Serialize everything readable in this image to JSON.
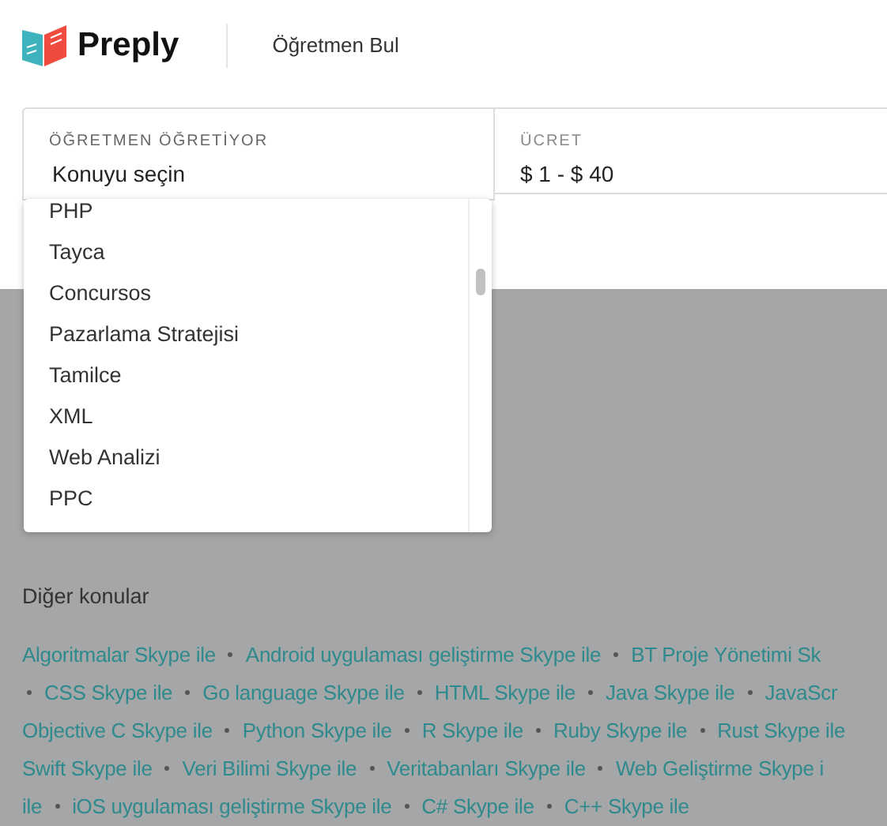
{
  "header": {
    "brand": "Preply",
    "nav_link": "Öğretmen Bul"
  },
  "filters": {
    "subject": {
      "label": "ÖĞRETMEN ÖĞRETİYOR",
      "placeholder": "Konuyu seçin",
      "expanded": true
    },
    "price": {
      "label": "ÜCRET",
      "value": "$ 1 - $ 40"
    }
  },
  "subject_options": [
    "PHP",
    "Tayca",
    "Concursos",
    "Pazarlama Stratejisi",
    "Tamilce",
    "XML",
    "Web Analizi",
    "PPC"
  ],
  "other_topics": {
    "title": "Diğer konular",
    "rows": [
      {
        "leading_separator": false,
        "links": [
          "Algoritmalar Skype ile",
          "Android uygulaması geliştirme Skype ile",
          "BT Proje Yönetimi Sk"
        ]
      },
      {
        "leading_separator": true,
        "links": [
          "CSS Skype ile",
          "Go language Skype ile",
          "HTML Skype ile",
          "Java Skype ile",
          "JavaScr"
        ]
      },
      {
        "leading_separator": false,
        "links": [
          "Objective C Skype ile",
          "Python Skype ile",
          "R Skype ile",
          "Ruby Skype ile",
          "Rust Skype ile"
        ]
      },
      {
        "leading_separator": false,
        "links": [
          "Swift Skype ile",
          "Veri Bilimi Skype ile",
          "Veritabanları Skype ile",
          "Web Geliştirme Skype i"
        ]
      },
      {
        "leading_separator": false,
        "links": [
          "ile",
          "iOS uygulaması geliştirme Skype ile",
          "C# Skype ile",
          "C++ Skype ile"
        ]
      }
    ]
  }
}
